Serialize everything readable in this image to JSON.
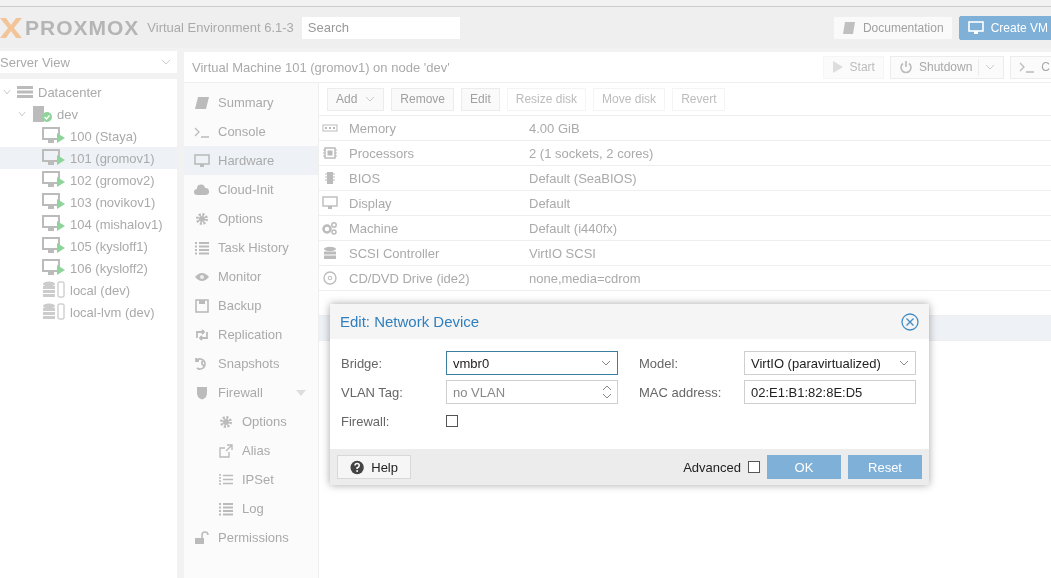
{
  "header": {
    "logo": "PROXMOX",
    "version": "Virtual Environment 6.1-3",
    "search": {
      "placeholder": "Search"
    },
    "buttons": [
      {
        "label": "Documentation",
        "kind": "doc"
      },
      {
        "label": "Create VM",
        "kind": "create"
      }
    ]
  },
  "sidebar": {
    "view_selector": "Server View",
    "tree": [
      {
        "label": "Datacenter",
        "kind": "datacenter",
        "selected": false,
        "expanded": true,
        "children": [
          {
            "label": "dev",
            "kind": "node",
            "selected": false,
            "expanded": true,
            "children": [
              {
                "label": "100 (Staya)",
                "kind": "vm",
                "selected": false
              },
              {
                "label": "101 (gromov1)",
                "kind": "vm",
                "selected": true
              },
              {
                "label": "102 (gromov2)",
                "kind": "vm",
                "selected": false
              },
              {
                "label": "103 (novikov1)",
                "kind": "vm",
                "selected": false
              },
              {
                "label": "104 (mishalov1)",
                "kind": "vm",
                "selected": false
              },
              {
                "label": "105 (kysloff1)",
                "kind": "vm",
                "selected": false
              },
              {
                "label": "106 (kysloff2)",
                "kind": "vm",
                "selected": false
              },
              {
                "label": "local (dev)",
                "kind": "storage",
                "selected": false
              },
              {
                "label": "local-lvm (dev)",
                "kind": "storage",
                "selected": false
              }
            ]
          }
        ]
      }
    ]
  },
  "panel": {
    "title": "Virtual Machine 101 (gromov1) on node 'dev'",
    "actions": [
      {
        "label": "Start",
        "kind": "start",
        "disabled": true
      },
      {
        "label": "Shutdown",
        "kind": "shutdown",
        "disabled": false
      },
      {
        "label": "C",
        "kind": "console",
        "disabled": false
      }
    ]
  },
  "nav": [
    {
      "label": "Summary",
      "kind": "book",
      "selected": false
    },
    {
      "label": "Console",
      "kind": "terminal",
      "selected": false
    },
    {
      "label": "Hardware",
      "kind": "monitor",
      "selected": true
    },
    {
      "label": "Cloud-Init",
      "kind": "cloud",
      "selected": false
    },
    {
      "label": "Options",
      "kind": "gear",
      "selected": false
    },
    {
      "label": "Task History",
      "kind": "list",
      "selected": false
    },
    {
      "label": "Monitor",
      "kind": "eye",
      "selected": false
    },
    {
      "label": "Backup",
      "kind": "floppy",
      "selected": false
    },
    {
      "label": "Replication",
      "kind": "retweet",
      "selected": false
    },
    {
      "label": "Snapshots",
      "kind": "history",
      "selected": false
    },
    {
      "label": "Firewall",
      "kind": "shield",
      "selected": false,
      "expanded": true,
      "children": [
        {
          "label": "Options",
          "kind": "gear",
          "selected": false
        },
        {
          "label": "Alias",
          "kind": "external",
          "selected": false
        },
        {
          "label": "IPSet",
          "kind": "olist",
          "selected": false
        },
        {
          "label": "Log",
          "kind": "list",
          "selected": false
        }
      ]
    },
    {
      "label": "Permissions",
      "kind": "unlock",
      "selected": false
    }
  ],
  "hardware": {
    "toolbar": [
      {
        "label": "Add",
        "disabled": false,
        "menu": true
      },
      {
        "label": "Remove",
        "disabled": false,
        "menu": false
      },
      {
        "label": "Edit",
        "disabled": false,
        "menu": false
      },
      {
        "label": "Resize disk",
        "disabled": true,
        "menu": false
      },
      {
        "label": "Move disk",
        "disabled": true,
        "menu": false
      },
      {
        "label": "Revert",
        "disabled": true,
        "menu": false
      }
    ],
    "rows": [
      {
        "kind": "memory",
        "name": "Memory",
        "value": "4.00 GiB"
      },
      {
        "kind": "cpu",
        "name": "Processors",
        "value": "2 (1 sockets, 2 cores)"
      },
      {
        "kind": "chip",
        "name": "BIOS",
        "value": "Default (SeaBIOS)"
      },
      {
        "kind": "monitor",
        "name": "Display",
        "value": "Default"
      },
      {
        "kind": "gears",
        "name": "Machine",
        "value": "Default (i440fx)"
      },
      {
        "kind": "database",
        "name": "SCSI Controller",
        "value": "VirtIO SCSI"
      },
      {
        "kind": "disc",
        "name": "CD/DVD Drive (ide2)",
        "value": "none,media=cdrom"
      }
    ]
  },
  "dialog": {
    "title": "Edit: Network Device",
    "fields": [
      {
        "label": "Bridge:",
        "kind": "combo",
        "value": "vmbr0",
        "focused": true
      },
      {
        "label": "Model:",
        "kind": "combo",
        "value": "VirtIO (paravirtualized)",
        "focused": false
      },
      {
        "label": "VLAN Tag:",
        "kind": "spinner",
        "placeholder": "no VLAN",
        "focused": false
      },
      {
        "label": "MAC address:",
        "kind": "text",
        "value": "02:E1:B1:82:8E:D5",
        "focused": false
      },
      {
        "label": "Firewall:",
        "kind": "checkbox",
        "checked": false
      }
    ],
    "help": "Help",
    "advanced": {
      "label": "Advanced",
      "checked": false
    },
    "buttons": [
      {
        "label": "OK"
      },
      {
        "label": "Reset"
      }
    ]
  }
}
